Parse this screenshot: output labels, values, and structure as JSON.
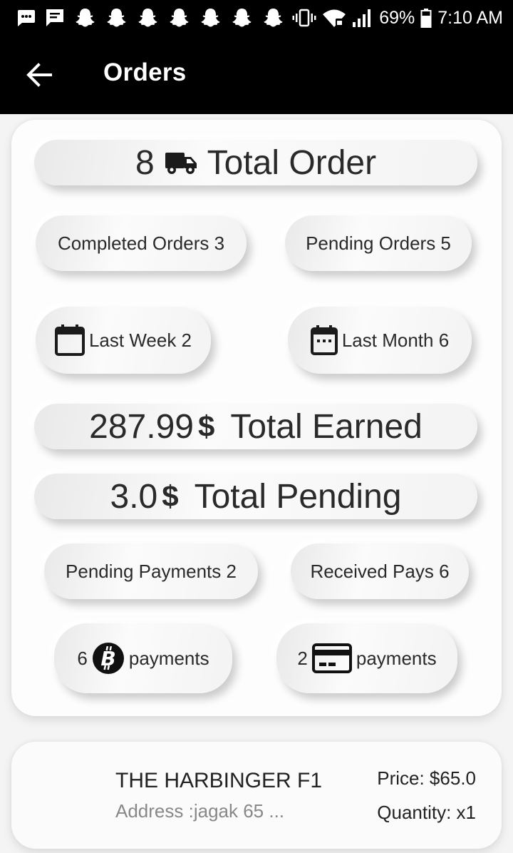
{
  "status_bar": {
    "battery": "69%",
    "time": "7:10 AM"
  },
  "app_bar": {
    "title": "Orders",
    "back_icon": "arrow-back-icon"
  },
  "summary": {
    "total_order": {
      "count": "8",
      "label": "Total Order",
      "icon": "truck-icon"
    },
    "completed_orders": "Completed Orders 3",
    "pending_orders": "Pending Orders 5",
    "last_week": "Last Week 2",
    "last_month": "Last Month 6",
    "total_earned": {
      "amount": "287.99",
      "currency": "$",
      "label": "Total Earned"
    },
    "total_pending": {
      "amount": "3.0",
      "currency": "$",
      "label": "Total Pending"
    },
    "pending_payments": "Pending Payments 2",
    "received_pays": "Received Pays 6",
    "bitcoin_payments": {
      "count": "6",
      "label": "payments",
      "icon": "bitcoin-icon"
    },
    "card_payments": {
      "count": "2",
      "label": "payments",
      "icon": "credit-card-icon"
    }
  },
  "orders": [
    {
      "title": "THE HARBINGER F1",
      "address": "Address :jagak 65 ...",
      "price": "Price: $65.0",
      "quantity": "Quantity: x1"
    }
  ]
}
